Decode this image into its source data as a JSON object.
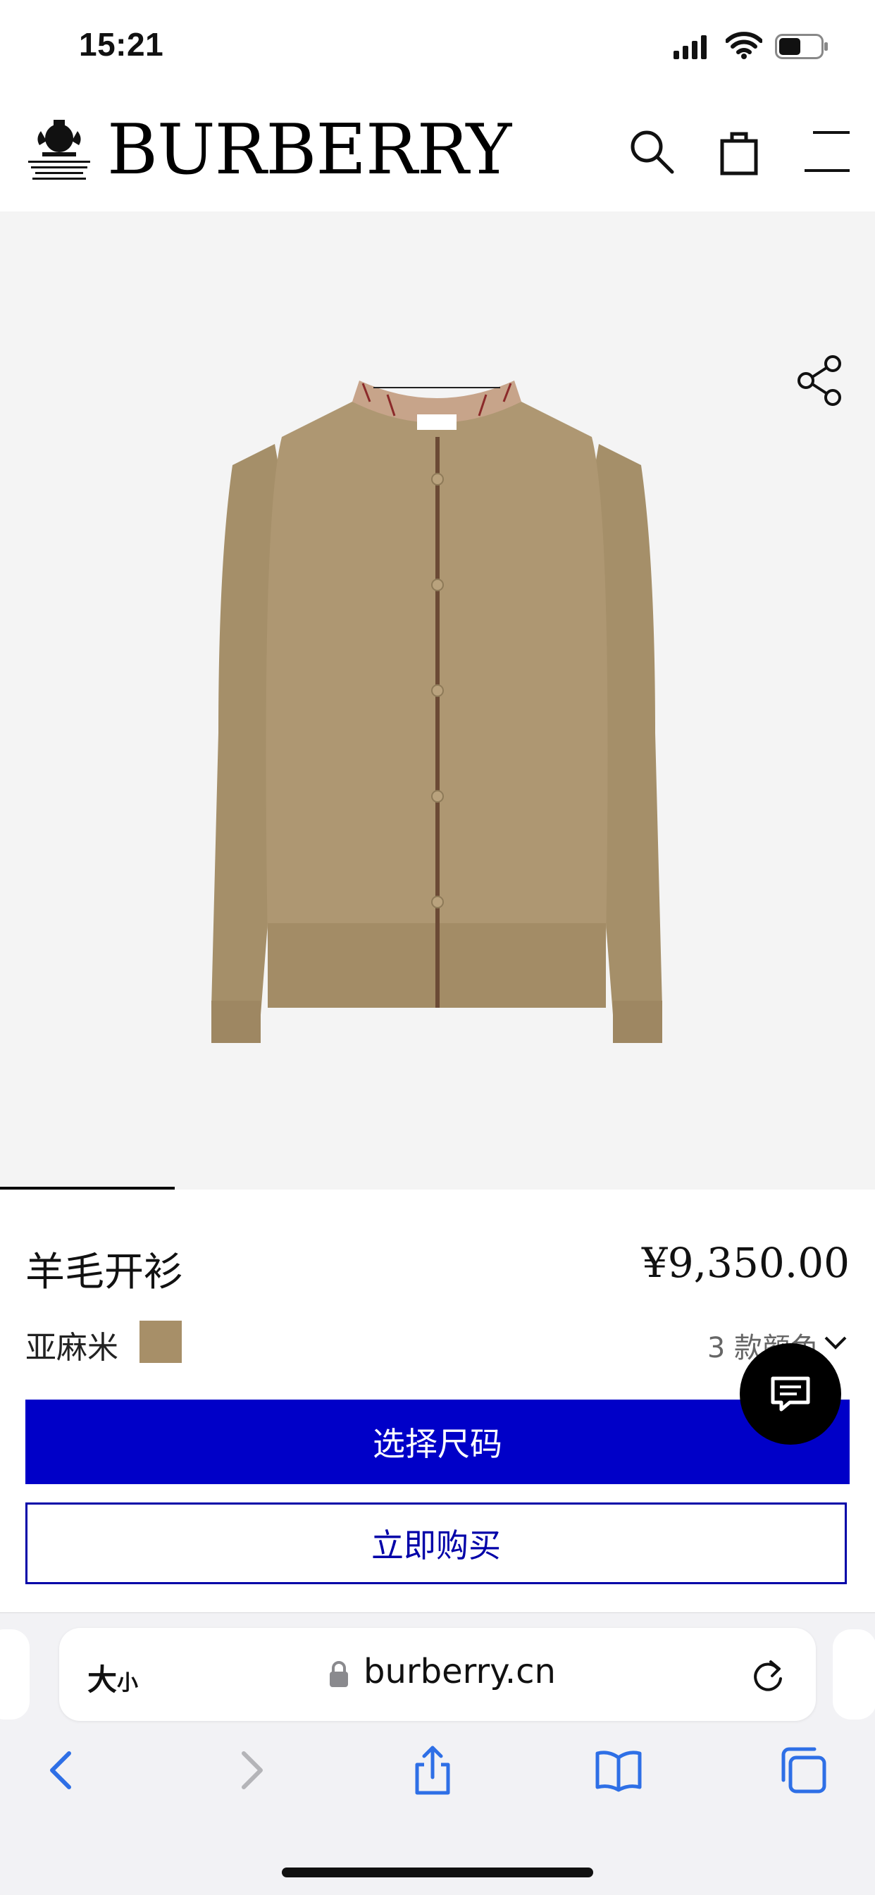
{
  "status_bar": {
    "time": "15:21"
  },
  "header": {
    "brand": "BURBERRY"
  },
  "product": {
    "title": "羊毛开衫",
    "price": "¥9,350.00",
    "color_name": "亚麻米",
    "color_swatch_hex": "#a78f68",
    "color_count": "3 款颜色",
    "select_size_label": "选择尺码",
    "buy_now_label": "立即购买",
    "gallery_progress_fraction": 0.2
  },
  "browser": {
    "text_size_large": "大",
    "text_size_small": "小",
    "url": "burberry.cn"
  },
  "colors": {
    "primary_blue": "#0000c8",
    "gallery_bg": "#f4f4f4"
  },
  "icons": [
    "search-icon",
    "shopping-bag-icon",
    "menu-icon",
    "share-icon",
    "chat-icon",
    "lock-icon",
    "reload-icon",
    "back-icon",
    "forward-icon",
    "share-sheet-icon",
    "bookmarks-icon",
    "tabs-icon",
    "chevron-down-icon"
  ]
}
